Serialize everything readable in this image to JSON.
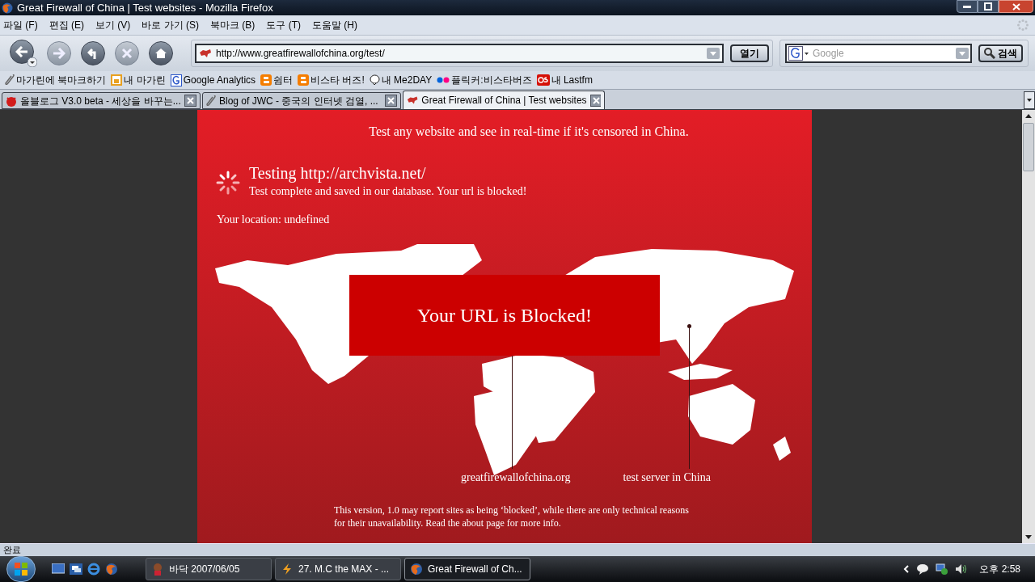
{
  "window": {
    "title": "Great Firewall of China | Test websites - Mozilla Firefox"
  },
  "menu": [
    "파일 (F)",
    "편집 (E)",
    "보기 (V)",
    "바로 가기 (S)",
    "북마크 (B)",
    "도구 (T)",
    "도움말 (H)"
  ],
  "address": {
    "value": "http://www.greatfirewallofchina.org/test/"
  },
  "go_button": "열기",
  "search": {
    "placeholder": "Google"
  },
  "search_button": "검색",
  "bookmarks": [
    "마가린에 북마크하기",
    "내 마가린",
    "Google Analytics",
    "쉼터",
    "비스타 버즈!",
    "내 Me2DAY",
    "플릭커:비스타버즈",
    "내 Lastfm"
  ],
  "tabs": [
    {
      "label": "올블로그 V3.0 beta - 세상을 바꾸는...",
      "selected": false
    },
    {
      "label": "Blog of JWC - 중국의 인터넷 검열, ...",
      "selected": false
    },
    {
      "label": "Great Firewall of China | Test websites",
      "selected": true
    }
  ],
  "page": {
    "tagline": "Test any website and see in real-time if it's censored in China.",
    "testing_title": "Testing http://archvista.net/",
    "testing_status": "Test complete and saved in our database. Your url is blocked!",
    "location": "Your location: undefined",
    "banner": "Your URL is Blocked!",
    "map_labels": [
      "greatfirewallofchina.org",
      "test server in China"
    ],
    "disclaimer": "This version, 1.0 may report sites as being ‘blocked’, while there are only technical reasons for their unavailability. Read the about page for more info."
  },
  "status_bar": "완료",
  "taskbar": {
    "tasks": [
      {
        "label": "바닥 2007/06/05",
        "selected": false
      },
      {
        "label": "27. M.C the MAX - ...",
        "selected": false
      },
      {
        "label": "Great Firewall of Ch...",
        "selected": true
      }
    ],
    "clock": "오후 2:58"
  }
}
